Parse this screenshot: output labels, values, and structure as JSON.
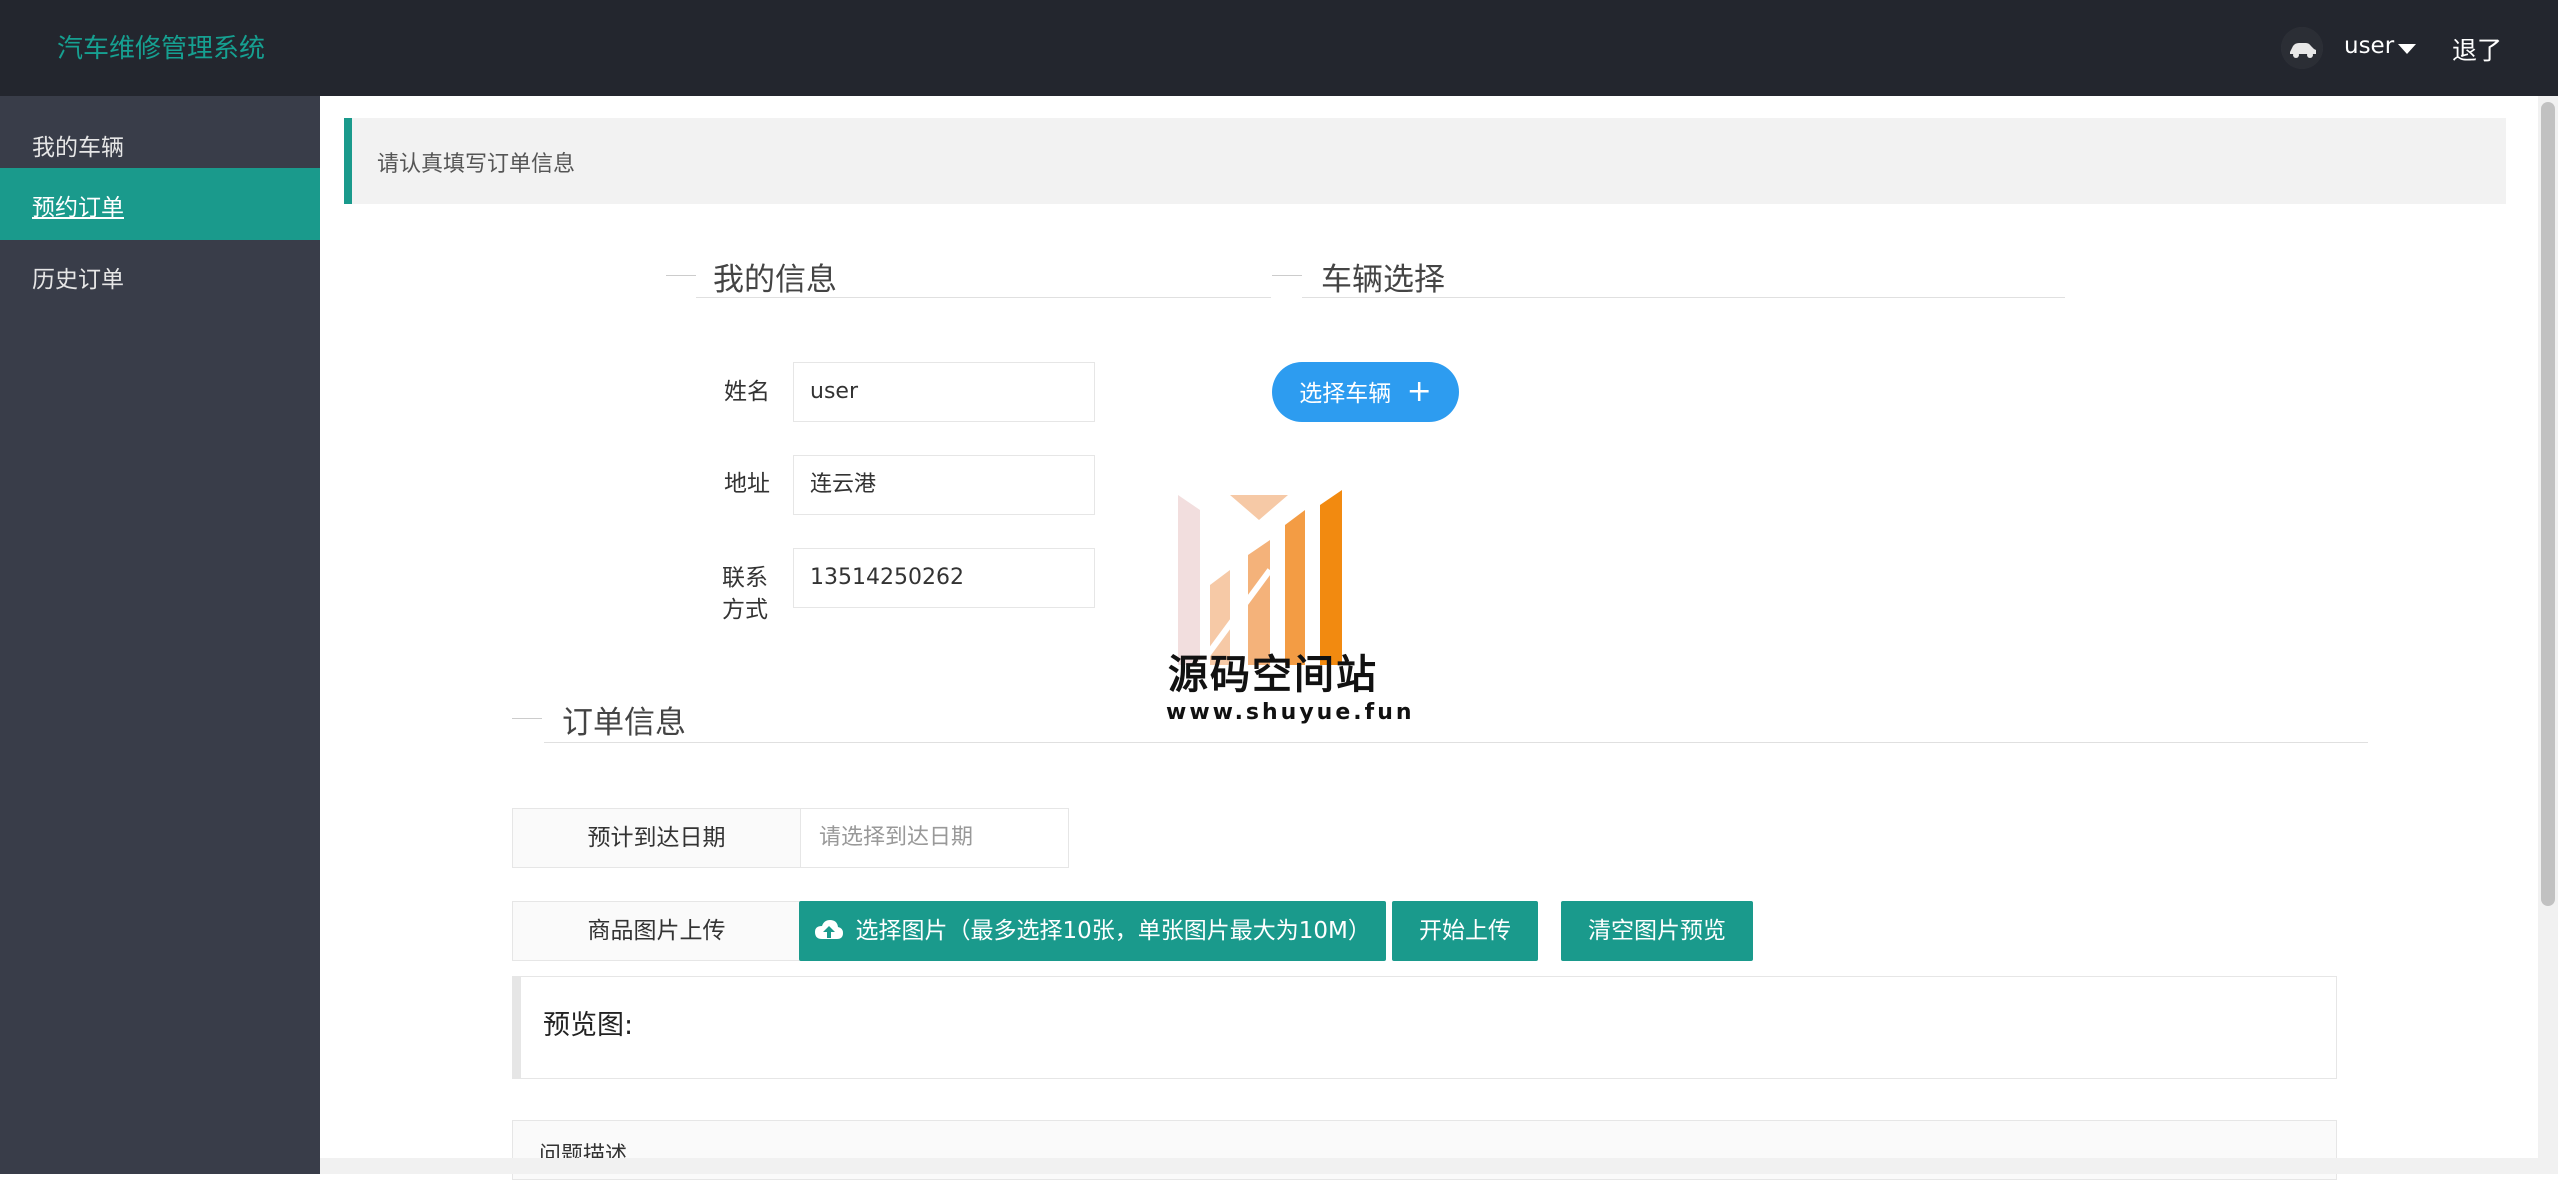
{
  "header": {
    "app_title": "汽车维修管理系统",
    "user_name": "user",
    "logout_label": "退了"
  },
  "sidebar": {
    "items": [
      {
        "label": "我的车辆"
      },
      {
        "label": "预约订单",
        "active": true
      },
      {
        "label": "历史订单"
      }
    ]
  },
  "notice": "请认真填写订单信息",
  "sections": {
    "my_info": "我的信息",
    "vehicle": "车辆选择",
    "order_info": "订单信息"
  },
  "my_info": {
    "name_label": "姓名",
    "name_value": "user",
    "address_label": "地址",
    "address_value": "连云港",
    "contact_label": "联系方式",
    "contact_value": "13514250262"
  },
  "vehicle": {
    "select_button": "选择车辆"
  },
  "order": {
    "date_label": "预计到达日期",
    "date_placeholder": "请选择到达日期",
    "upload_label": "商品图片上传",
    "choose_images_button": "选择图片（最多选择10张，单张图片最大为10M）",
    "start_upload_button": "开始上传",
    "clear_preview_button": "清空图片预览",
    "preview_label": "预览图:",
    "description_label": "问题描述"
  },
  "watermark": {
    "title": "源码空间站",
    "url": "www.shuyue.fun"
  },
  "colors": {
    "header_bg": "#23262e",
    "sidebar_bg": "#393d49",
    "accent": "#1a9a8c",
    "pill_blue": "#2d9cf0"
  }
}
